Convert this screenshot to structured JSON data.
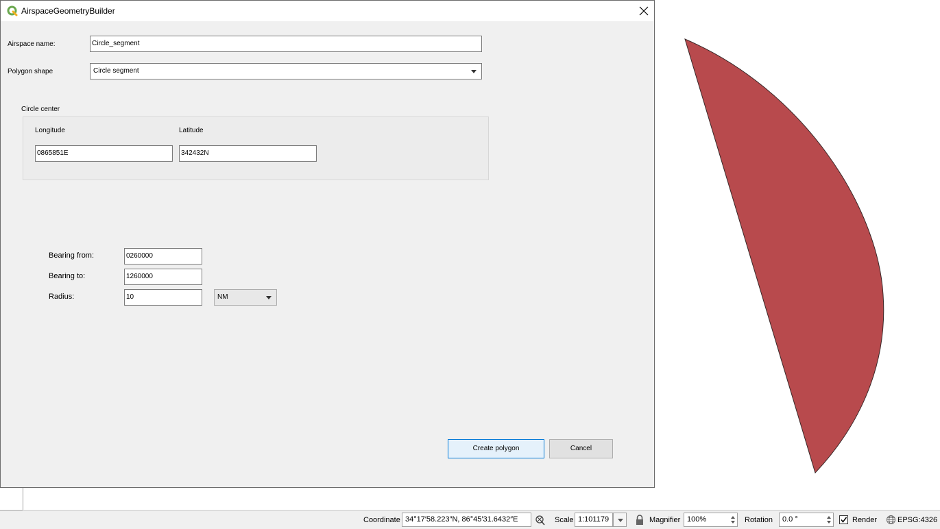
{
  "dialog": {
    "title": "AirspaceGeometryBuilder",
    "airspace_name_label": "Airspace name:",
    "airspace_name_value": "Circle_segment",
    "polygon_shape_label": "Polygon shape",
    "polygon_shape_value": "Circle segment",
    "circle_center": {
      "title": "Circle center",
      "longitude_label": "Longitude",
      "longitude_value": "0865851E",
      "latitude_label": "Latitude",
      "latitude_value": "342432N"
    },
    "bearing_from_label": "Bearing from:",
    "bearing_from_value": "0260000",
    "bearing_to_label": "Bearing to:",
    "bearing_to_value": "1260000",
    "radius_label": "Radius:",
    "radius_value": "10",
    "radius_unit": "NM",
    "create_button": "Create polygon",
    "cancel_button": "Cancel"
  },
  "map": {
    "segment_fill": "#b84a4d",
    "segment_stroke": "#3a2a2a"
  },
  "statusbar": {
    "coordinate_label": "Coordinate",
    "coordinate_value": "34°17′58.223″N, 86°45′31.6432″E",
    "scale_label": "Scale",
    "scale_value": "1:101179",
    "magnifier_label": "Magnifier",
    "magnifier_value": "100%",
    "rotation_label": "Rotation",
    "rotation_value": "0.0 °",
    "render_label": "Render",
    "render_checked": true,
    "crs_value": "EPSG:4326"
  }
}
